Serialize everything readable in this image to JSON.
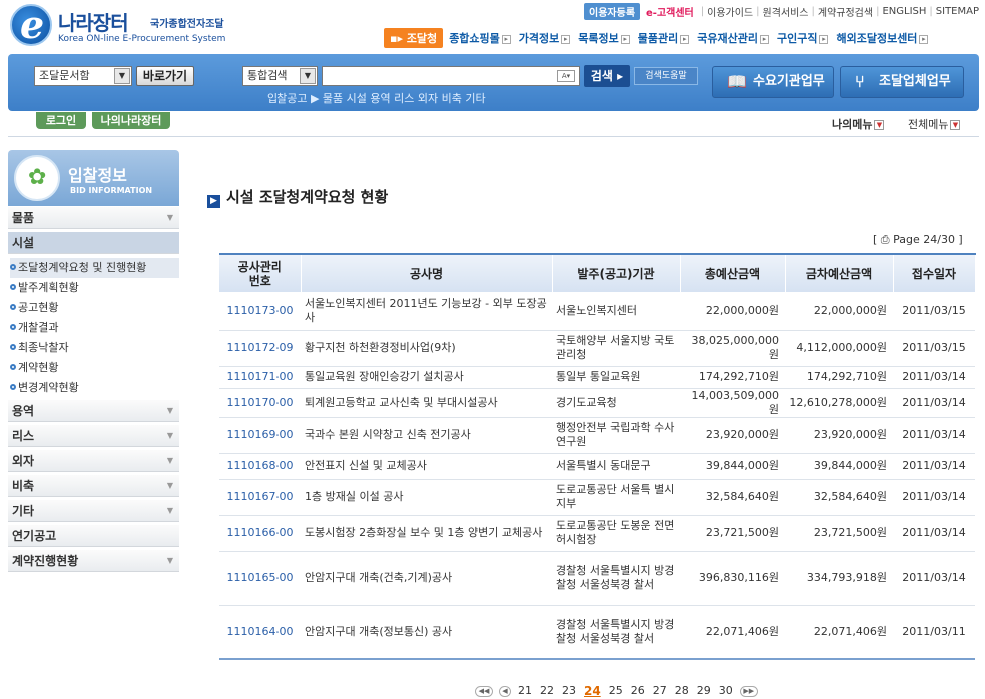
{
  "header": {
    "logo_main": "나라장터",
    "logo_sub": "국가종합전자조달",
    "logo_eng": "Korea ON-line E-Procurement System",
    "user_badge": "이용자등록",
    "ecenter": "e-고객센터",
    "top_links": [
      "이용가이드",
      "원격서비스",
      "계약규정검색",
      "ENGLISH",
      "SITEMAP"
    ],
    "current_menu": "조달청",
    "gnb": [
      "종합쇼핑몰",
      "가격정보",
      "목록정보",
      "물품관리",
      "국유재산관리",
      "구인구직",
      "해외조달정보센터"
    ]
  },
  "search": {
    "doc_select": "조달문서함",
    "go_label": "바로가기",
    "scope_select": "통합검색",
    "ime": "A",
    "search_label": "검색",
    "help_label": "검색도움말",
    "categories": "입찰공고 ▶ 물품 시설 용역 리스 외자 비축 기타",
    "org_button": "수요기관업무",
    "biz_button": "조달업체업무"
  },
  "nav": {
    "login": "로그인",
    "my_nara": "나의나라장터",
    "my_menu": "나의메뉴",
    "all_menu": "전체메뉴"
  },
  "sidebar": {
    "title": "입찰정보",
    "subtitle": "BID INFORMATION",
    "items_top": [
      "물품",
      "시설"
    ],
    "sub_items": [
      "조달청계약요청 및 진행현황",
      "발주계획현황",
      "공고현황",
      "개찰결과",
      "최종낙찰자",
      "계약현황",
      "변경계약현황"
    ],
    "items_bottom": [
      "용역",
      "리스",
      "외자",
      "비축",
      "기타",
      "연기공고",
      "계약진행현황"
    ]
  },
  "main": {
    "title": "시설 조달청계약요청 현황",
    "page_info": "Page 24/30",
    "columns": [
      "공사관리\n번호",
      "공사명",
      "발주(공고)기관",
      "총예산금액",
      "금차예산금액",
      "접수일자"
    ],
    "rows": [
      {
        "no": "1110173-00",
        "name": "서울노인복지센터 2011년도 기능보강 - 외부 도장공사",
        "org": "서울노인복지센터",
        "total": "22,000,000원",
        "current": "22,000,000원",
        "date": "2011/03/15"
      },
      {
        "no": "1110172-09",
        "name": "황구지천 하천환경정비사업(9차)",
        "org": "국토해양부 서울지방 국토관리청",
        "total": "38,025,000,000원",
        "current": "4,112,000,000원",
        "date": "2011/03/15"
      },
      {
        "no": "1110171-00",
        "name": "통일교육원 장애인승강기 설치공사",
        "org": "통일부 통일교육원",
        "total": "174,292,710원",
        "current": "174,292,710원",
        "date": "2011/03/14"
      },
      {
        "no": "1110170-00",
        "name": "퇴계원고등학교 교사신축 및 부대시설공사",
        "org": "경기도교육청",
        "total": "14,003,509,000원",
        "current": "12,610,278,000원",
        "date": "2011/03/14"
      },
      {
        "no": "1110169-00",
        "name": "국과수 본원 시약창고 신축 전기공사",
        "org": "행정안전부 국립과학 수사연구원",
        "total": "23,920,000원",
        "current": "23,920,000원",
        "date": "2011/03/14"
      },
      {
        "no": "1110168-00",
        "name": "안전표지 신설 및 교체공사",
        "org": "서울특별시 동대문구",
        "total": "39,844,000원",
        "current": "39,844,000원",
        "date": "2011/03/14"
      },
      {
        "no": "1110167-00",
        "name": "1층 방재실 이설 공사",
        "org": "도로교통공단 서울특 별시지부",
        "total": "32,584,640원",
        "current": "32,584,640원",
        "date": "2011/03/14"
      },
      {
        "no": "1110166-00",
        "name": "도봉시험장 2층화장실 보수 및 1층 양변기 교체공사",
        "org": "도로교통공단 도봉운 전면허시험장",
        "total": "23,721,500원",
        "current": "23,721,500원",
        "date": "2011/03/14"
      },
      {
        "no": "1110165-00",
        "name": "안암지구대 개축(건축,기계)공사",
        "org": "경찰청 서울특별시지 방경찰청 서울성북경 찰서",
        "total": "396,830,116원",
        "current": "334,793,918원",
        "date": "2011/03/14"
      },
      {
        "no": "1110164-00",
        "name": "안암지구대 개축(정보통신) 공사",
        "org": "경찰청 서울특별시지 방경찰청 서울성북경 찰서",
        "total": "22,071,406원",
        "current": "22,071,406원",
        "date": "2011/03/11"
      }
    ]
  },
  "pager": {
    "pages": [
      "21",
      "22",
      "23",
      "24",
      "25",
      "26",
      "27",
      "28",
      "29",
      "30"
    ],
    "current": "24"
  }
}
